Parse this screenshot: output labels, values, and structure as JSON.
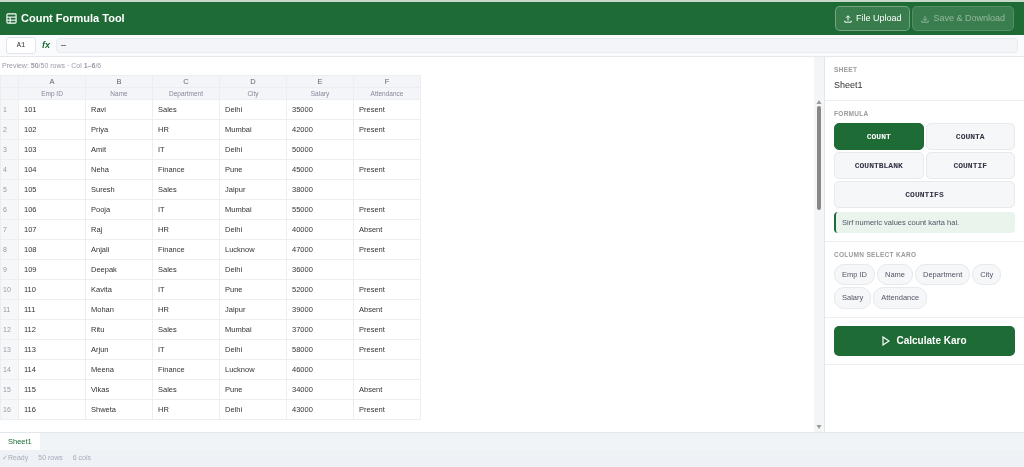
{
  "app": {
    "title": "Count Formula Tool"
  },
  "toolbar": {
    "buttons": [
      {
        "label": "File Upload",
        "kind": "upload",
        "disabled": false
      },
      {
        "label": "Save & Download",
        "kind": "download",
        "disabled": true
      }
    ]
  },
  "formula_bar": {
    "cell_ref": "A1",
    "fx": "fx",
    "value": "–"
  },
  "preview": "Preview: **50**/50 rows · Col **1–6**/6",
  "table": {
    "letters": [
      "A",
      "B",
      "C",
      "D",
      "E",
      "F"
    ],
    "columns": [
      "Emp ID",
      "Name",
      "Department",
      "City",
      "Salary",
      "Attendance"
    ],
    "rows": [
      {
        "n": "1",
        "cells": [
          "101",
          "Ravi",
          "Sales",
          "Delhi",
          "35000",
          "Present"
        ]
      },
      {
        "n": "2",
        "cells": [
          "102",
          "Priya",
          "HR",
          "Mumbai",
          "42000",
          "Present"
        ]
      },
      {
        "n": "3",
        "cells": [
          "103",
          "Amit",
          "IT",
          "Delhi",
          "50000",
          ""
        ]
      },
      {
        "n": "4",
        "cells": [
          "104",
          "Neha",
          "Finance",
          "Pune",
          "45000",
          "Present"
        ]
      },
      {
        "n": "5",
        "cells": [
          "105",
          "Suresh",
          "Sales",
          "Jaipur",
          "38000",
          ""
        ]
      },
      {
        "n": "6",
        "cells": [
          "106",
          "Pooja",
          "IT",
          "Mumbai",
          "55000",
          "Present"
        ]
      },
      {
        "n": "7",
        "cells": [
          "107",
          "Raj",
          "HR",
          "Delhi",
          "40000",
          "Absent"
        ]
      },
      {
        "n": "8",
        "cells": [
          "108",
          "Anjali",
          "Finance",
          "Lucknow",
          "47000",
          "Present"
        ]
      },
      {
        "n": "9",
        "cells": [
          "109",
          "Deepak",
          "Sales",
          "Delhi",
          "36000",
          ""
        ]
      },
      {
        "n": "10",
        "cells": [
          "110",
          "Kavita",
          "IT",
          "Pune",
          "52000",
          "Present"
        ]
      },
      {
        "n": "11",
        "cells": [
          "111",
          "Mohan",
          "HR",
          "Jaipur",
          "39000",
          "Absent"
        ]
      },
      {
        "n": "12",
        "cells": [
          "112",
          "Ritu",
          "Sales",
          "Mumbai",
          "37000",
          "Present"
        ]
      },
      {
        "n": "13",
        "cells": [
          "113",
          "Arjun",
          "IT",
          "Delhi",
          "58000",
          "Present"
        ]
      },
      {
        "n": "14",
        "cells": [
          "114",
          "Meena",
          "Finance",
          "Lucknow",
          "46000",
          ""
        ]
      },
      {
        "n": "15",
        "cells": [
          "115",
          "Vikas",
          "Sales",
          "Pune",
          "34000",
          "Absent"
        ]
      },
      {
        "n": "16",
        "cells": [
          "116",
          "Shweta",
          "HR",
          "Delhi",
          "43000",
          "Present"
        ]
      }
    ]
  },
  "sheet_tabs": [
    {
      "label": "Sheet1",
      "selected": true
    }
  ],
  "status_bar": {
    "ready": "✓Ready",
    "rows": "50 rows",
    "cols": "6 cols"
  },
  "panel": {
    "sheet_label": "SHEET",
    "sheet_name": "Sheet1",
    "formula_label": "FORMULA",
    "formulas": [
      {
        "label": "COUNT",
        "selected": true
      },
      {
        "label": "COUNTA",
        "selected": false
      },
      {
        "label": "COUNTBLANK",
        "selected": false
      },
      {
        "label": "COUNTIF",
        "selected": false
      },
      {
        "label": "COUNTIFS",
        "selected": false
      }
    ],
    "note": "Sirf numeric values count karta hai.",
    "column_label": "COLUMN SELECT KARO",
    "column_chips": [
      {
        "label": "Emp ID",
        "selected": false
      },
      {
        "label": "Name",
        "selected": false
      },
      {
        "label": "Department",
        "selected": false
      },
      {
        "label": "City",
        "selected": false
      },
      {
        "label": "Salary",
        "selected": false
      },
      {
        "label": "Attendance",
        "selected": false
      }
    ],
    "calculate": "Calculate Karo"
  }
}
